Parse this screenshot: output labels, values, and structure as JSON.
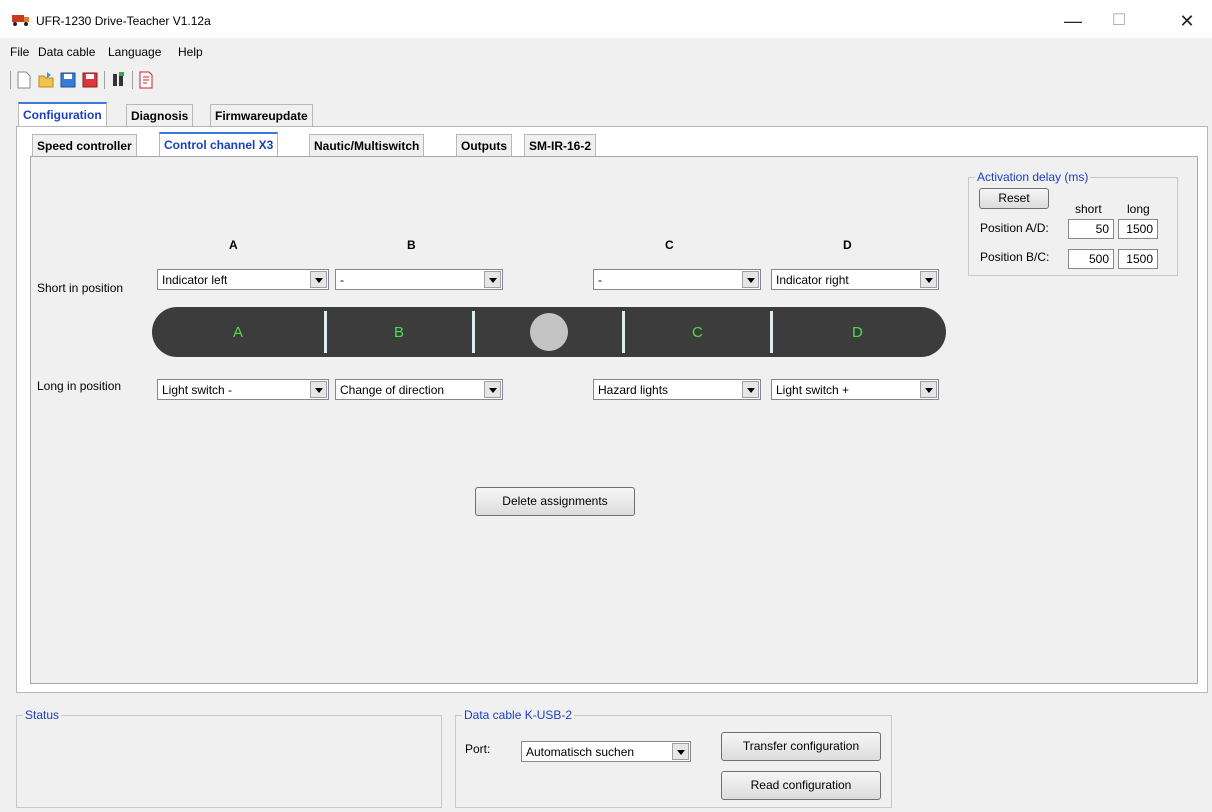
{
  "window": {
    "title": "UFR-1230 Drive-Teacher V1.12a",
    "min_glyph": "—",
    "max_glyph": "☐",
    "close_glyph": "✕"
  },
  "menu": [
    "File",
    "Data cable",
    "Language",
    "Help"
  ],
  "tabs_main": [
    "Configuration",
    "Diagnosis",
    "Firmwareupdate"
  ],
  "tabs_sub": [
    "Speed controller",
    "Control channel X3",
    "Nautic/Multiswitch",
    "Outputs",
    "SM-IR-16-2"
  ],
  "control_channel": {
    "columns": [
      "A",
      "B",
      "C",
      "D"
    ],
    "short_label": "Short in position",
    "long_label": "Long in position",
    "short": [
      "Indicator left",
      "-",
      "-",
      "Indicator right"
    ],
    "long": [
      "Light switch -",
      "Change of direction",
      "Hazard lights",
      "Light switch +"
    ],
    "stick_segments": [
      "A",
      "B",
      "C",
      "D"
    ],
    "delete_label": "Delete assignments"
  },
  "activation_delay": {
    "legend": "Activation delay (ms)",
    "reset_label": "Reset",
    "short_header": "short",
    "long_header": "long",
    "pos_ad_label": "Position A/D:",
    "pos_bc_label": "Position B/C:",
    "ad_short": "50",
    "ad_long": "1500",
    "bc_short": "500",
    "bc_long": "1500"
  },
  "status": {
    "legend": "Status"
  },
  "data_cable": {
    "legend": "Data cable K-USB-2",
    "port_label": "Port:",
    "port_value": "Automatisch suchen",
    "transfer_label": "Transfer configuration",
    "read_label": "Read configuration"
  },
  "colors": {
    "segment_text": "#4ede4e",
    "stick_bar": "#3c3c3c",
    "active_tab": "#1c3fbf"
  },
  "icons": [
    "truck-app-icon",
    "new-file-icon",
    "open-folder-icon",
    "save-icon",
    "save-as-icon",
    "connect-icon",
    "pdf-icon"
  ]
}
